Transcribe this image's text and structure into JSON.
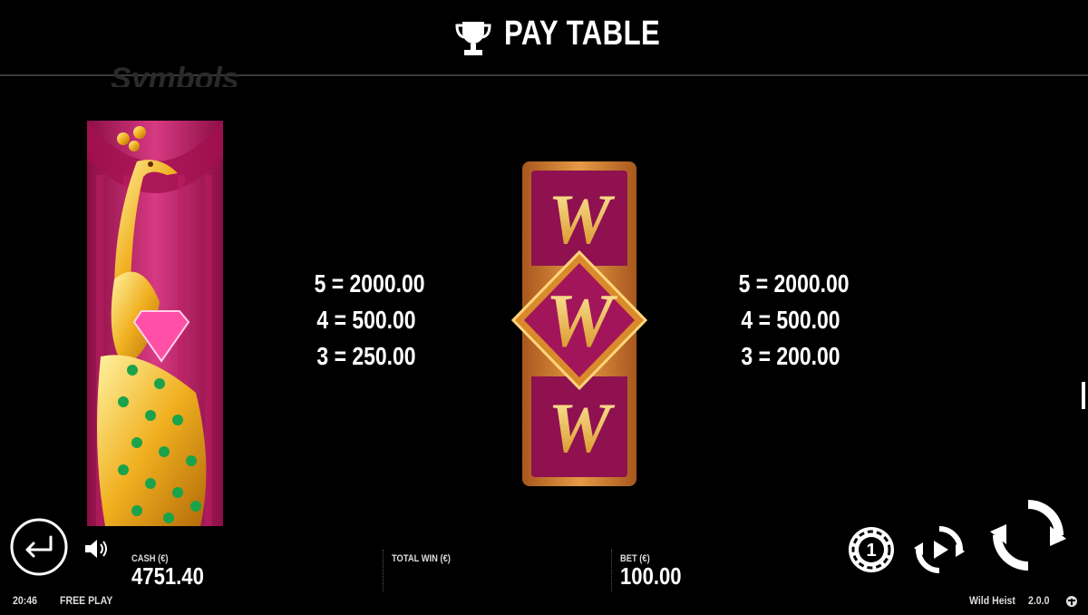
{
  "header": {
    "title": "PAY TABLE"
  },
  "section": {
    "ghost_title": "Symbols"
  },
  "symbols": [
    {
      "name": "Golden Peacock",
      "payouts": [
        "5 = 2000.00",
        "4 = 500.00",
        "3 = 250.00"
      ]
    },
    {
      "name": "Wild",
      "letter": "W",
      "payouts": [
        "5 = 2000.00",
        "4 = 500.00",
        "3 = 200.00"
      ]
    }
  ],
  "footer": {
    "cash_label": "CASH (€)",
    "cash_value": "4751.40",
    "total_win_label": "TOTAL WIN (€)",
    "bet_label": "BET (€)",
    "bet_value": "100.00",
    "coin_value": "1",
    "clock": "20:46",
    "mode": "FREE PLAY",
    "game_name": "Wild Heist",
    "version": "2.0.0"
  },
  "icons": [
    "trophy-icon",
    "back-arrow-icon",
    "speaker-icon",
    "coin-value-icon",
    "autoplay-icon",
    "spin-icon",
    "logo-icon"
  ],
  "colors": {
    "background": "#000000",
    "text": "#ffffff",
    "symbol_magenta": "#b0145a",
    "symbol_gold": "#e8a628"
  }
}
